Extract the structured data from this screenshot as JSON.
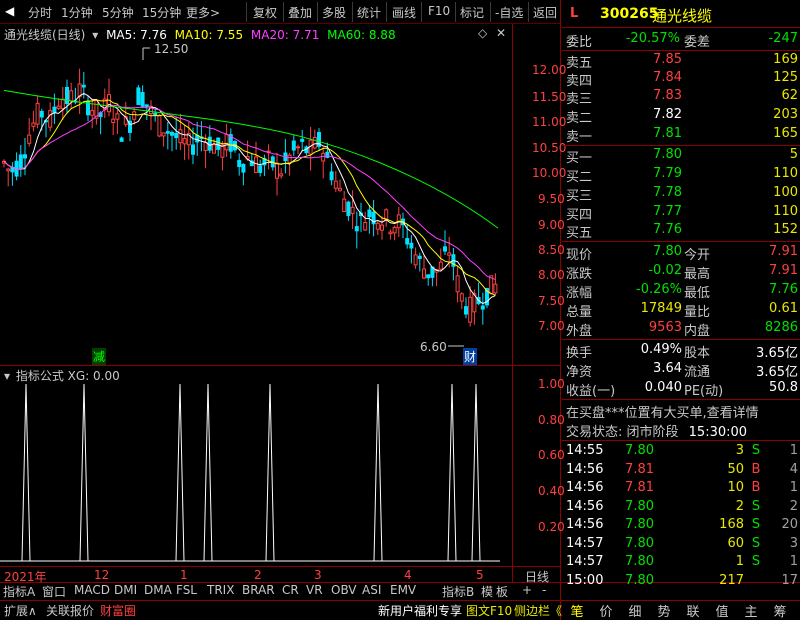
{
  "toolbar": {
    "items": [
      "分时",
      "1分钟",
      "5分钟",
      "15分钟",
      "更多>"
    ],
    "right_items": [
      "复权",
      "叠加",
      "多股",
      "统计",
      "画线",
      "F10",
      "标记",
      "-自选",
      "返回"
    ]
  },
  "chart_header": {
    "title": "通光线缆(日线)",
    "ma5": "MA5: 7.76",
    "ma10": "MA10: 7.55",
    "ma20": "MA20: 7.71",
    "ma60": "MA60: 8.88"
  },
  "price_axis": [
    "12.00",
    "11.50",
    "11.00",
    "10.50",
    "10.00",
    "9.50",
    "9.00",
    "8.50",
    "8.00",
    "7.50",
    "7.00"
  ],
  "high_label": "12.50",
  "low_label": "6.60",
  "marker_jian": "减",
  "marker_cai": "财",
  "indicator_header": "指标公式 XG: 0.00",
  "indicator_axis": [
    "1.00",
    "0.80",
    "0.60",
    "0.40",
    "0.20"
  ],
  "date_axis": {
    "labels": [
      "2021年",
      "12",
      "1",
      "2",
      "3",
      "4",
      "5"
    ],
    "period": "日线"
  },
  "indicator_tabs": [
    "指标A",
    "窗口",
    "MACD",
    "DMI",
    "DMA",
    "FSL",
    "TRIX",
    "BRAR",
    "CR",
    "VR",
    "OBV",
    "ASI",
    "EMV",
    "指标B",
    "模",
    "板",
    "+",
    "-"
  ],
  "bottom_bar": {
    "expand": "扩展∧",
    "related": "关联报价",
    "fortune": "财富圈",
    "promo": "新用户福利专享",
    "f10": "图文F10",
    "sidebar": "侧边栏《"
  },
  "right_tabs": [
    "笔",
    "价",
    "细",
    "势",
    "联",
    "值",
    "主",
    "筹"
  ],
  "stock": {
    "flag": "L",
    "code": "300265",
    "name": "通光线缆"
  },
  "weibi": {
    "label1": "委比",
    "value1": "-20.57%",
    "label2": "委差",
    "value2": "-247"
  },
  "sell": [
    {
      "label": "卖五",
      "price": "7.85",
      "vol": "169"
    },
    {
      "label": "卖四",
      "price": "7.84",
      "vol": "125"
    },
    {
      "label": "卖三",
      "price": "7.83",
      "vol": "62"
    },
    {
      "label": "卖二",
      "price": "7.82",
      "vol": "203"
    },
    {
      "label": "卖一",
      "price": "7.81",
      "vol": "165"
    }
  ],
  "buy": [
    {
      "label": "买一",
      "price": "7.80",
      "vol": "5"
    },
    {
      "label": "买二",
      "price": "7.79",
      "vol": "110"
    },
    {
      "label": "买三",
      "price": "7.78",
      "vol": "100"
    },
    {
      "label": "买四",
      "price": "7.77",
      "vol": "110"
    },
    {
      "label": "买五",
      "price": "7.76",
      "vol": "152"
    }
  ],
  "quote": [
    {
      "l1": "现价",
      "v1": "7.80",
      "c1": "green",
      "l2": "今开",
      "v2": "7.91",
      "c2": "red"
    },
    {
      "l1": "涨跌",
      "v1": "-0.02",
      "c1": "green",
      "l2": "最高",
      "v2": "7.91",
      "c2": "red"
    },
    {
      "l1": "涨幅",
      "v1": "-0.26%",
      "c1": "green",
      "l2": "最低",
      "v2": "7.76",
      "c2": "green"
    },
    {
      "l1": "总量",
      "v1": "17849",
      "c1": "yellow",
      "l2": "量比",
      "v2": "0.61",
      "c2": "yellow"
    },
    {
      "l1": "外盘",
      "v1": "9563",
      "c1": "red",
      "l2": "内盘",
      "v2": "8286",
      "c2": "green"
    }
  ],
  "fund": [
    {
      "l1": "换手",
      "v1": "0.49%",
      "l2": "股本",
      "v2": "3.65亿"
    },
    {
      "l1": "净资",
      "v1": "3.64",
      "l2": "流通",
      "v2": "3.65亿"
    },
    {
      "l1": "收益(一)",
      "v1": "0.040",
      "l2": "PE(动)",
      "v2": "50.8"
    }
  ],
  "notice": "在买盘***位置有大买单,查看详情",
  "trade_status": {
    "label": "交易状态: 闭市阶段",
    "time": "15:30:00"
  },
  "ticks": [
    {
      "time": "14:55",
      "price": "7.80",
      "vol": "3",
      "bs": "S",
      "n": "1"
    },
    {
      "time": "14:56",
      "price": "7.81",
      "vol": "50",
      "bs": "B",
      "n": "4"
    },
    {
      "time": "14:56",
      "price": "7.81",
      "vol": "10",
      "bs": "B",
      "n": "1"
    },
    {
      "time": "14:56",
      "price": "7.80",
      "vol": "2",
      "bs": "S",
      "n": "2"
    },
    {
      "time": "14:56",
      "price": "7.80",
      "vol": "168",
      "bs": "S",
      "n": "20"
    },
    {
      "time": "14:57",
      "price": "7.80",
      "vol": "60",
      "bs": "S",
      "n": "3"
    },
    {
      "time": "14:57",
      "price": "7.80",
      "vol": "1",
      "bs": "S",
      "n": "1"
    },
    {
      "time": "15:00",
      "price": "7.80",
      "vol": "217",
      "bs": "",
      "n": "17"
    }
  ],
  "colors": {
    "up": "#ff4040",
    "down": "#00e0ff",
    "ma5": "#ffffff",
    "ma10": "#ffff00",
    "ma20": "#ff40ff",
    "ma60": "#00ff00",
    "border": "#8b0000"
  }
}
